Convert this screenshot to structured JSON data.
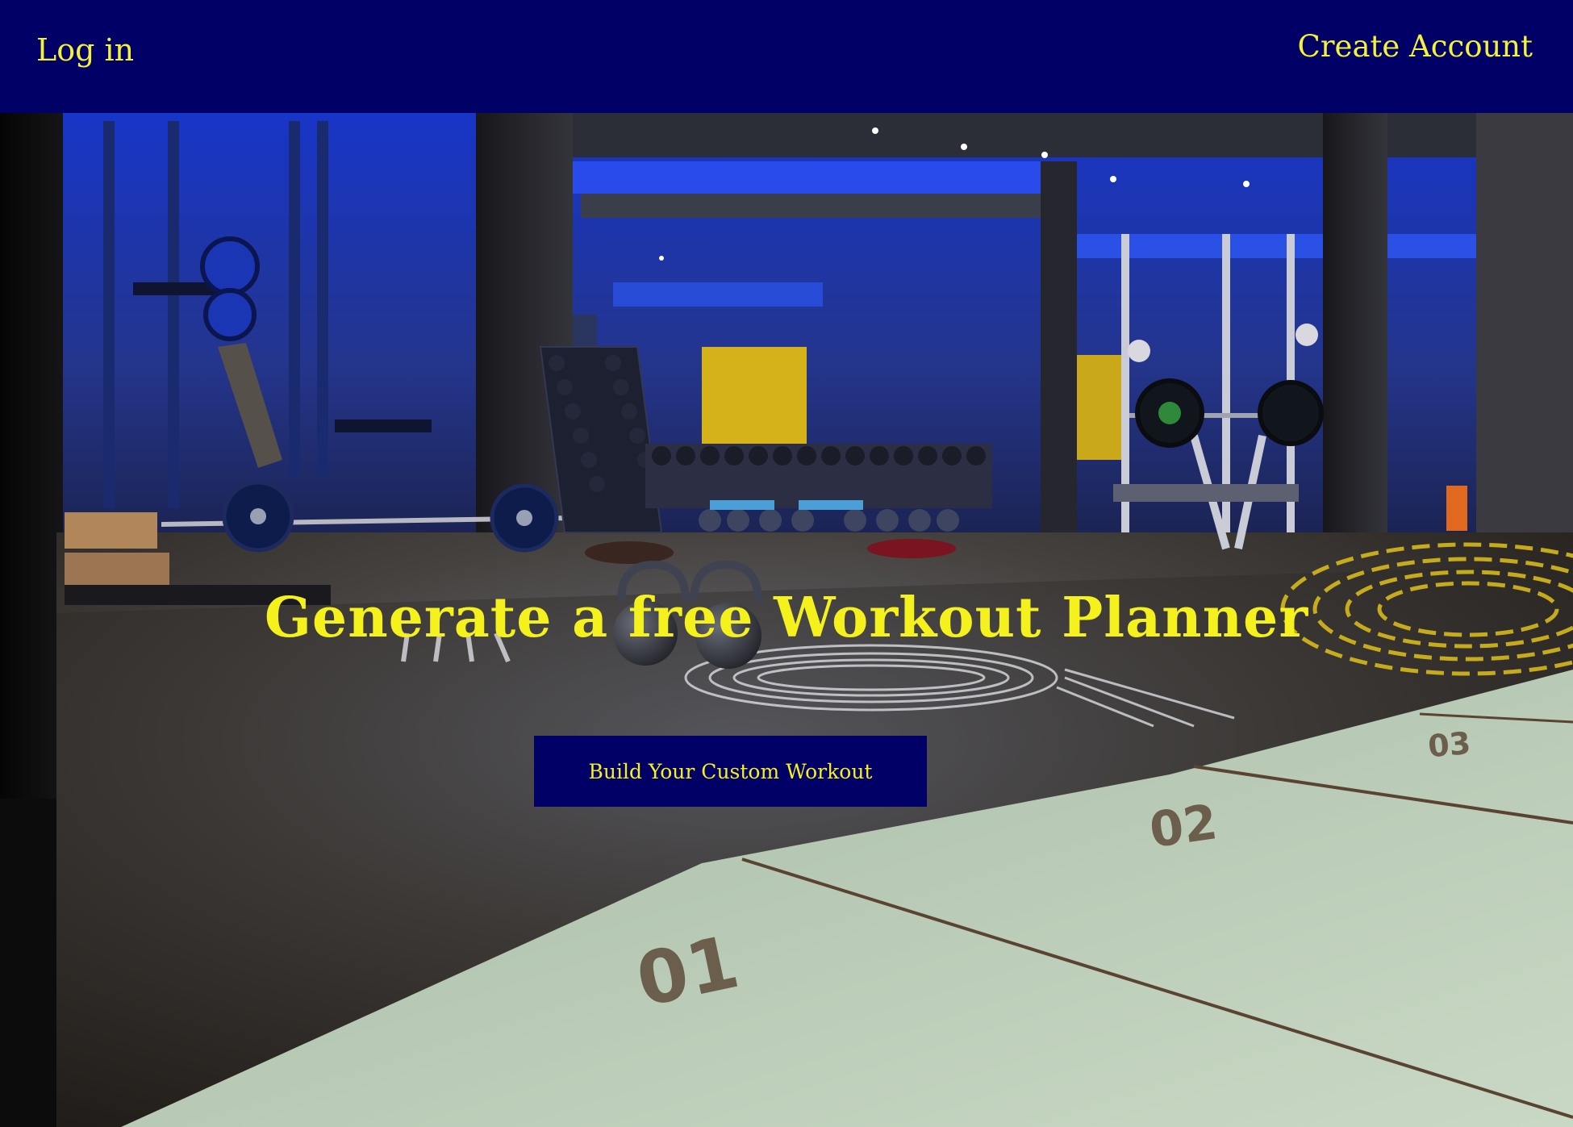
{
  "nav": {
    "login_label": "Log in",
    "create_account_label": "Create Account"
  },
  "hero": {
    "title": "Generate a free Workout Planner",
    "cta_label": "Build Your Custom Workout",
    "background_image": "gym-interior-photo",
    "lane_numbers": [
      "01",
      "02",
      "03"
    ]
  },
  "colors": {
    "nav_background": "#000066",
    "accent_text": "#f5f11c",
    "gym_blue_light": "#1f3fd6",
    "floor_dark": "#3a3a3a",
    "floor_mint": "#b8cdb6"
  }
}
